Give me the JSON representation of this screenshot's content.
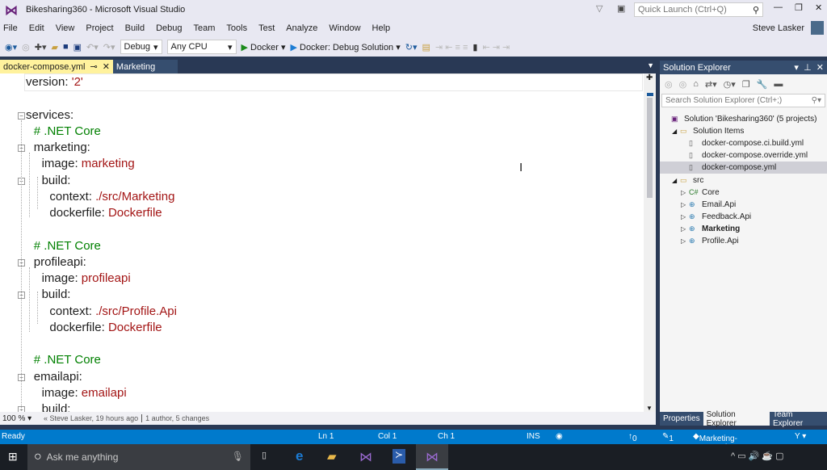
{
  "window": {
    "title": "Bikesharing360 - Microsoft Visual Studio",
    "quick_launch_placeholder": "Quick Launch (Ctrl+Q)",
    "user": "Steve Lasker"
  },
  "menu": [
    "File",
    "Edit",
    "View",
    "Project",
    "Build",
    "Debug",
    "Team",
    "Tools",
    "Test",
    "Analyze",
    "Window",
    "Help"
  ],
  "toolbar": {
    "config": "Debug",
    "platform": "Any CPU",
    "run_target": "Docker",
    "debug_target": "Docker: Debug Solution"
  },
  "tabs": [
    {
      "label": "docker-compose.yml",
      "active": true
    },
    {
      "label": "Marketing",
      "active": false
    }
  ],
  "editor": {
    "lines": [
      {
        "indent": 0,
        "key": "version: ",
        "value": "'2'"
      },
      {
        "indent": 0,
        "key": "",
        "value": ""
      },
      {
        "indent": 0,
        "key": "services:",
        "value": ""
      },
      {
        "indent": 1,
        "comment": "# .NET Core"
      },
      {
        "indent": 1,
        "key": "marketing:",
        "value": ""
      },
      {
        "indent": 2,
        "key": "image: ",
        "value": "marketing"
      },
      {
        "indent": 2,
        "key": "build:",
        "value": ""
      },
      {
        "indent": 3,
        "key": "context: ",
        "value": "./src/Marketing"
      },
      {
        "indent": 3,
        "key": "dockerfile: ",
        "value": "Dockerfile"
      },
      {
        "indent": 0,
        "key": "",
        "value": ""
      },
      {
        "indent": 1,
        "comment": "# .NET Core"
      },
      {
        "indent": 1,
        "key": "profileapi:",
        "value": ""
      },
      {
        "indent": 2,
        "key": "image: ",
        "value": "profileapi"
      },
      {
        "indent": 2,
        "key": "build:",
        "value": ""
      },
      {
        "indent": 3,
        "key": "context: ",
        "value": "./src/Profile.Api"
      },
      {
        "indent": 3,
        "key": "dockerfile: ",
        "value": "Dockerfile"
      },
      {
        "indent": 0,
        "key": "",
        "value": ""
      },
      {
        "indent": 1,
        "comment": "# .NET Core"
      },
      {
        "indent": 1,
        "key": "emailapi:",
        "value": ""
      },
      {
        "indent": 2,
        "key": "image: ",
        "value": "emailapi"
      },
      {
        "indent": 2,
        "key": "build:",
        "value": ""
      }
    ],
    "zoom": "100 %",
    "blame": "Steve Lasker, 19 hours ago",
    "changes": "1 author, 5 changes"
  },
  "solution_explorer": {
    "title": "Solution Explorer",
    "search_placeholder": "Search Solution Explorer (Ctrl+;)",
    "items": [
      {
        "label": "Solution 'Bikesharing360' (5 projects)",
        "level": 0,
        "icon": "solution-icon"
      },
      {
        "label": "Solution Items",
        "level": 1,
        "icon": "folder-icon",
        "expanded": true
      },
      {
        "label": "docker-compose.ci.build.yml",
        "level": 2,
        "icon": "file-icon"
      },
      {
        "label": "docker-compose.override.yml",
        "level": 2,
        "icon": "file-icon"
      },
      {
        "label": "docker-compose.yml",
        "level": 2,
        "icon": "file-icon",
        "selected": true
      },
      {
        "label": "src",
        "level": 1,
        "icon": "folder-icon",
        "expanded": true
      },
      {
        "label": "Core",
        "level": 2,
        "icon": "csharp-project-icon",
        "collapsed": true
      },
      {
        "label": "Email.Api",
        "level": 2,
        "icon": "web-project-icon",
        "collapsed": true
      },
      {
        "label": "Feedback.Api",
        "level": 2,
        "icon": "web-project-icon",
        "collapsed": true
      },
      {
        "label": "Marketing",
        "level": 2,
        "icon": "web-project-icon",
        "collapsed": true,
        "bold": true
      },
      {
        "label": "Profile.Api",
        "level": 2,
        "icon": "web-project-icon",
        "collapsed": true
      }
    ],
    "tabs": [
      "Properties",
      "Solution Explorer",
      "Team Explorer"
    ]
  },
  "status": {
    "ready": "Ready",
    "ln": "Ln 1",
    "col": "Col 1",
    "ch": "Ch 1",
    "mode": "INS",
    "up": "0",
    "edits": "1",
    "branch": "Marketing-Campaign"
  },
  "taskbar": {
    "search": "Ask me anything"
  },
  "colors": {
    "status_bar": "#007acc",
    "tab_active": "#fff29d",
    "vs_purple": "#68217a",
    "string": "#a31515",
    "comment": "#008000"
  }
}
